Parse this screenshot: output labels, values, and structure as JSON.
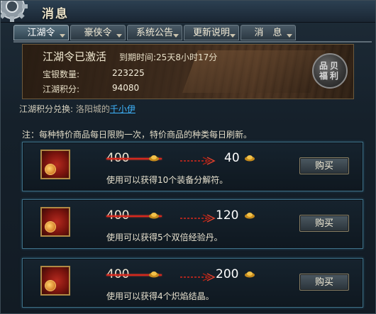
{
  "window": {
    "title": "消息"
  },
  "tabs": [
    {
      "label": "江湖令",
      "active": true
    },
    {
      "label": "豪侠令",
      "active": false
    },
    {
      "label": "系统公告",
      "active": false
    },
    {
      "label": "更新说明",
      "active": false
    },
    {
      "label": "消　息",
      "active": false
    }
  ],
  "banner": {
    "title": "江湖令已激活",
    "expire_text": "到期时间:25天8小时17分",
    "silver_label": "宝银数量:",
    "silver_value": "223225",
    "points_label": "江湖积分:",
    "points_value": "94080",
    "seal_text": "品贝福利"
  },
  "exchange": {
    "prefix": "江湖积分兑换:",
    "place": "洛阳城的",
    "npc_link": "千小伊"
  },
  "note": "注：每种特价商品每日限购一次，特价商品的种类每日刷新。",
  "items": [
    {
      "old_price": "400",
      "new_price": "40",
      "desc": "使用可以获得10个装备分解符。",
      "buy_label": "购买",
      "icon": "red-pouch-icon"
    },
    {
      "old_price": "400",
      "new_price": "120",
      "desc": "使用可以获得5个双倍经验丹。",
      "buy_label": "购买",
      "icon": "red-pouch-icon"
    },
    {
      "old_price": "400",
      "new_price": "200",
      "desc": "使用可以获得4个炽焰结晶。",
      "buy_label": "购买",
      "icon": "red-pouch-icon"
    }
  ],
  "colors": {
    "accent_gold": "#e0a830",
    "strike_red": "#d8281c",
    "link_blue": "#3fb6ff",
    "row_border": "#3f6f86"
  }
}
